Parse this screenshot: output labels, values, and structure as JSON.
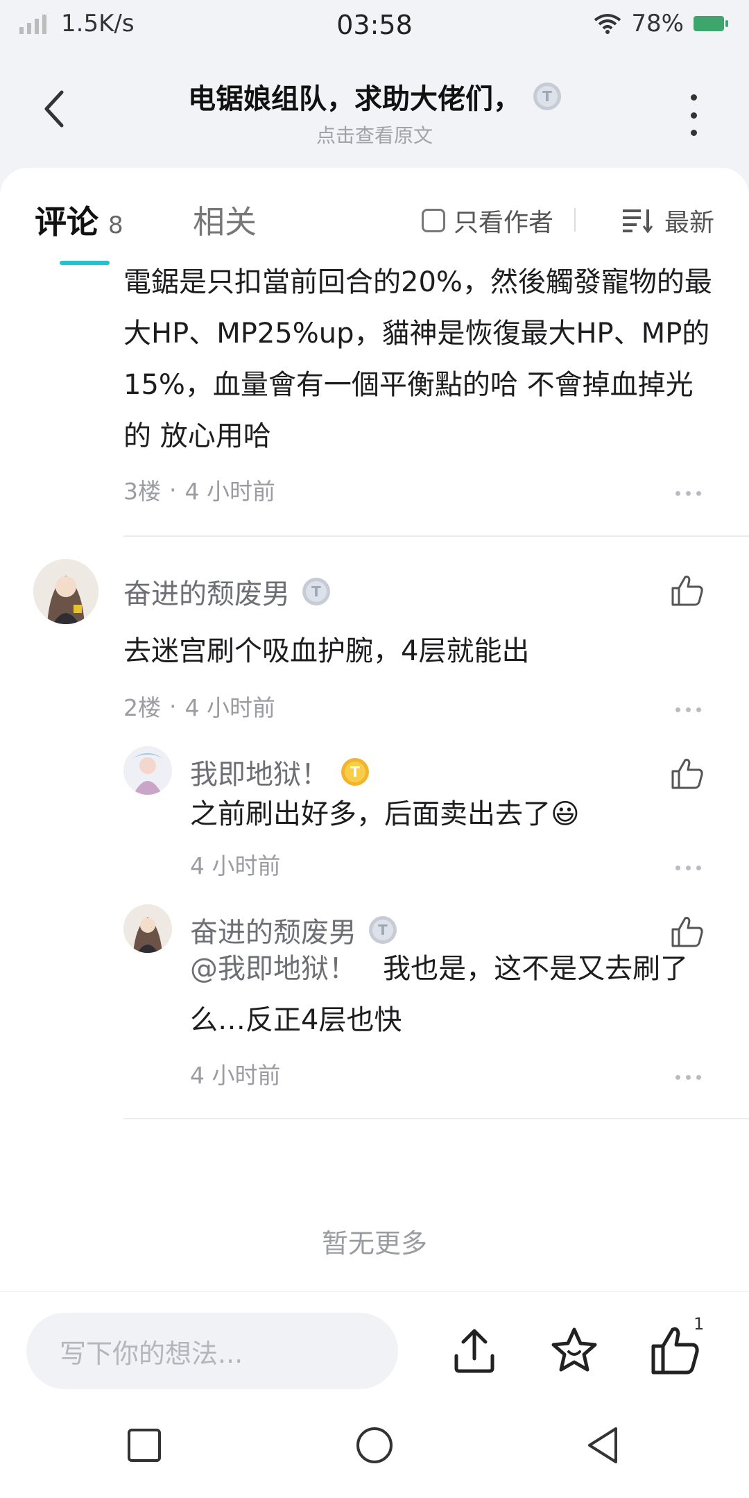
{
  "status_bar": {
    "net_speed": "1.5K/s",
    "time": "03:58",
    "battery": "78%"
  },
  "header": {
    "title": "电锯娘组队，求助大佬们，",
    "subtitle": "点击查看原文"
  },
  "tabs": {
    "comments_label": "评论",
    "comments_count": "8",
    "related_label": "相关",
    "author_only_label": "只看作者",
    "sort_label": "最新"
  },
  "comments": [
    {
      "text": "電鋸是只扣當前回合的20%，然後觸發寵物的最大HP、MP25%up，貓神是恢復最大HP、MP的15%，血量會有一個平衡點的哈 不會掉血掉光的 放心用哈",
      "floor": "3楼",
      "sep": "·",
      "time": "4 小时前"
    },
    {
      "user": "奋进的颓废男",
      "badge": "T",
      "text": "去迷宫刷个吸血护腕，4层就能出",
      "floor": "2楼",
      "sep": "·",
      "time": "4 小时前",
      "replies": [
        {
          "user": "我即地狱！",
          "badge": "T",
          "text": "之前刷出好多，后面卖出去了",
          "emoji": "😃",
          "time": "4 小时前"
        },
        {
          "user": "奋进的颓废男",
          "badge": "T",
          "mention": "@我即地狱！",
          "text": "我也是，这不是又去刷了么…反正4层也快",
          "time": "4 小时前"
        }
      ]
    }
  ],
  "no_more": "暂无更多",
  "bottom_bar": {
    "input_placeholder": "写下你的想法...",
    "like_count": "1"
  },
  "colors": {
    "accent": "#20c3d0",
    "gold_badge": "#f3b32a",
    "silver_badge": "#c6cbd6"
  }
}
